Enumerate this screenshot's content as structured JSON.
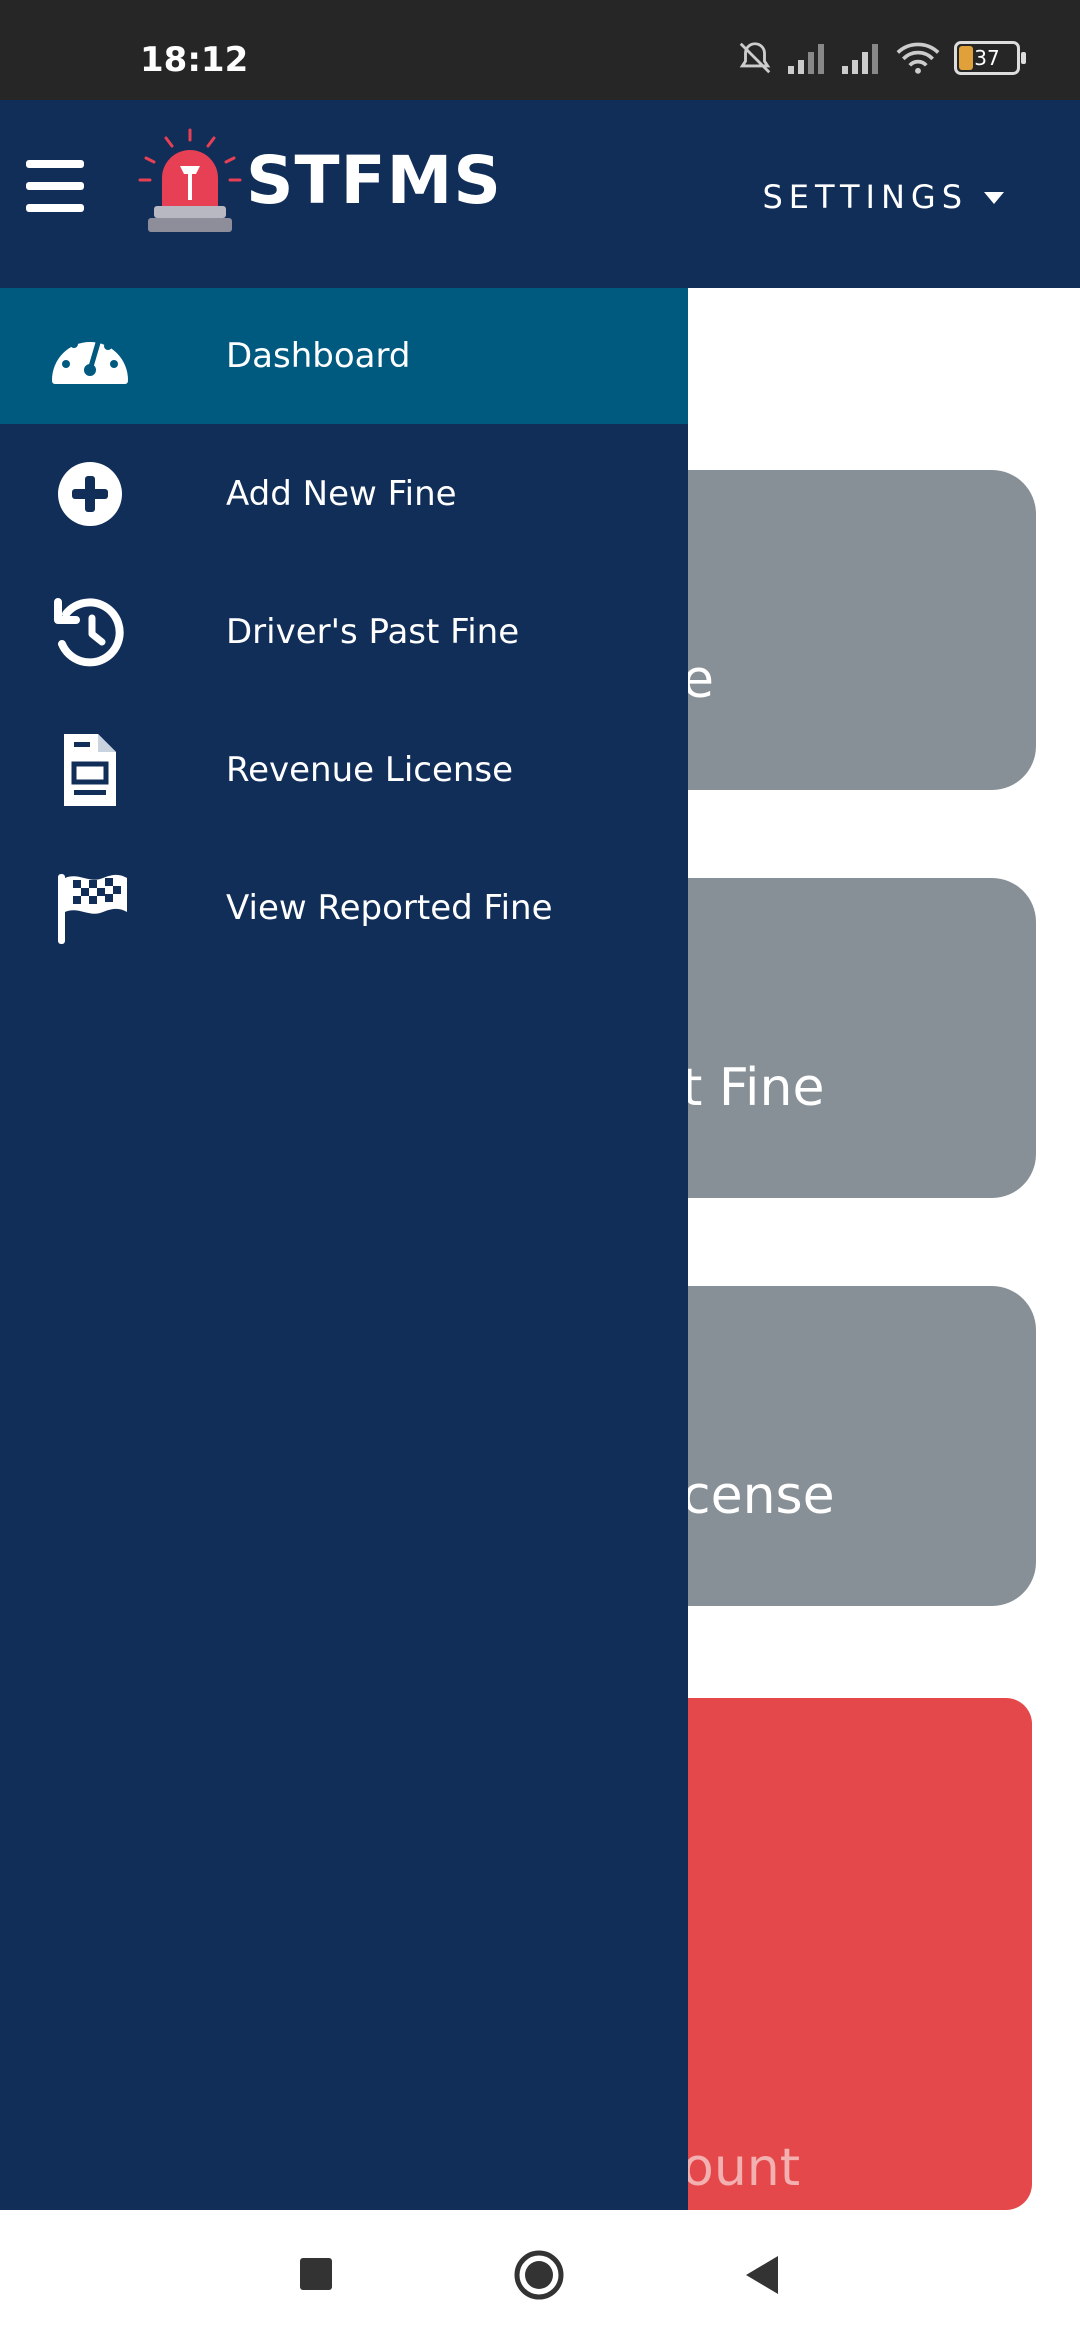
{
  "status_bar": {
    "time": "18:12",
    "battery": "37"
  },
  "app_bar": {
    "brand": "STFMS",
    "settings_label": "SETTINGS"
  },
  "drawer": {
    "items": [
      {
        "label": "Dashboard",
        "icon": "speedometer-icon",
        "active": true
      },
      {
        "label": "Add New Fine",
        "icon": "plus-circle-icon",
        "active": false
      },
      {
        "label": "Driver's Past Fine",
        "icon": "history-icon",
        "active": false
      },
      {
        "label": "Revenue License",
        "icon": "document-icon",
        "active": false
      },
      {
        "label": "View Reported Fine",
        "icon": "checkered-flag-icon",
        "active": false
      }
    ]
  },
  "background_cards": [
    {
      "visible_text": "e"
    },
    {
      "visible_text": "t Fine"
    },
    {
      "visible_text": "cense"
    },
    {
      "visible_text": "ount"
    }
  ],
  "colors": {
    "app_bar": "#102e58",
    "drawer_active": "#005a80",
    "card_gray": "#889097",
    "card_red": "#e5484a",
    "status_bar": "#262626"
  }
}
